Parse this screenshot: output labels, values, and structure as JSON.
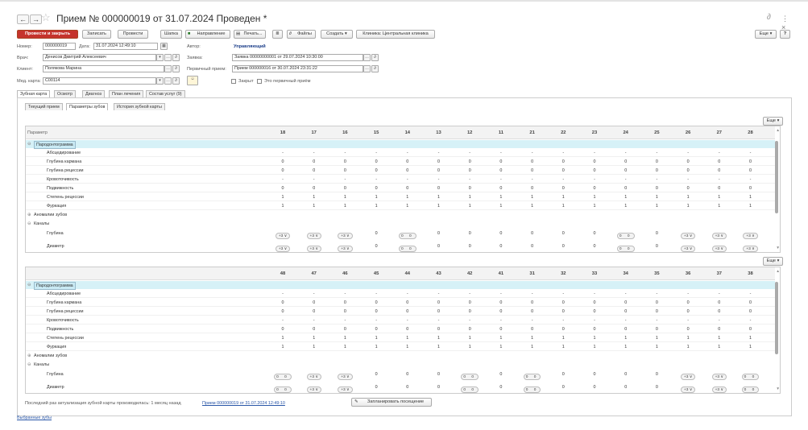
{
  "window": {
    "title": "Прием № 000000019 от 31.07.2024 Проведен *",
    "back": "←",
    "forward": "→",
    "star": "☆",
    "icons": "⋮ ×",
    "link_icon": "∂"
  },
  "toolbar": {
    "post_close": "Провести и закрыть",
    "save": "Записать",
    "post": "Провести",
    "header": "Шапка",
    "direction": "Направление",
    "print": "Печать...",
    "files": "Файлы",
    "create": "Создать",
    "clinic": "Клиника: Центральная клиника",
    "more": "Еще",
    "help": "?"
  },
  "form": {
    "number_label": "Номер:",
    "number": "000000019",
    "date_label": "Дата:",
    "date": "31.07.2024 12:49:10",
    "author_label": "Автор:",
    "author": "Управляющий",
    "doctor_label": "Врач:",
    "doctor": "Денисов Дмитрий Алексеевич",
    "request_label": "Заявка:",
    "request": "Заявка 00000000001 от 29.07.2024 10:30:00",
    "client_label": "Клиент:",
    "client": "Полякова Марина",
    "primary_label": "Первичный прием:",
    "primary": "Прием 000000016 от 30.07.2024 23:31:22",
    "card_label": "Мед. карта:",
    "card": "С00114",
    "closed_label": "Закрыт",
    "first_label": "Это первичный приём"
  },
  "tabs": [
    "Зубная карта",
    "Осмотр",
    "Диагноз",
    "План лечения",
    "Состав услуг (9)"
  ],
  "subtabs": [
    "Текущий прием",
    "Параметры зубов",
    "История зубной карты"
  ],
  "grid_more": "Еще",
  "upper": {
    "header_param": "Параметр",
    "teeth": [
      "18",
      "17",
      "16",
      "15",
      "14",
      "13",
      "12",
      "11",
      "21",
      "22",
      "23",
      "24",
      "25",
      "26",
      "27",
      "28"
    ],
    "group": "Пародонтограмма",
    "rows": [
      {
        "name": "Абсцедирование",
        "values": [
          "-",
          "-",
          "-",
          "-",
          "-",
          "-",
          "-",
          "-",
          "-",
          "-",
          "-",
          "-",
          "-",
          "-",
          "-",
          "-"
        ]
      },
      {
        "name": "Глубина кармана",
        "values": [
          "0",
          "0",
          "0",
          "0",
          "0",
          "0",
          "0",
          "0",
          "0",
          "0",
          "0",
          "0",
          "0",
          "0",
          "0",
          "0"
        ]
      },
      {
        "name": "Глубина рецессии",
        "values": [
          "0",
          "0",
          "0",
          "0",
          "0",
          "0",
          "0",
          "0",
          "0",
          "0",
          "0",
          "0",
          "0",
          "0",
          "0",
          "0"
        ]
      },
      {
        "name": "Кровоточивость",
        "values": [
          "-",
          "-",
          "-",
          "-",
          "-",
          "-",
          "-",
          "-",
          "-",
          "-",
          "-",
          "-",
          "-",
          "-",
          "-",
          "-"
        ]
      },
      {
        "name": "Подвижность",
        "values": [
          "0",
          "0",
          "0",
          "0",
          "0",
          "0",
          "0",
          "0",
          "0",
          "0",
          "0",
          "0",
          "0",
          "0",
          "0",
          "0"
        ]
      },
      {
        "name": "Степень рецессии",
        "values": [
          "1",
          "1",
          "1",
          "1",
          "1",
          "1",
          "1",
          "1",
          "1",
          "1",
          "1",
          "1",
          "1",
          "1",
          "1",
          "1"
        ]
      },
      {
        "name": "Фуркация",
        "values": [
          "1",
          "1",
          "1",
          "1",
          "1",
          "1",
          "1",
          "1",
          "1",
          "1",
          "1",
          "1",
          "1",
          "1",
          "1",
          "1"
        ]
      }
    ],
    "anomalies": "Аномалии зубов",
    "canals": "Каналы",
    "depth": "Глубина",
    "diameter": "Диаметр",
    "depth_values": [
      "+3 ∨",
      "+3 ∨",
      "+3 ∨",
      "0",
      "0 0",
      "0",
      "0",
      "0",
      "0",
      "0",
      "0",
      "0 0",
      "0",
      "+3 ∨",
      "+3 ∨",
      "+3 ∨"
    ],
    "diam_values": [
      "+3 ∨",
      "+3 ∨",
      "+3 ∨",
      "0",
      "0 0",
      "0",
      "0",
      "0",
      "0",
      "0",
      "0",
      "0 0",
      "0",
      "+3 ∨",
      "+3 ∨",
      "+3 ∨"
    ]
  },
  "lower": {
    "teeth": [
      "48",
      "47",
      "46",
      "45",
      "44",
      "43",
      "42",
      "41",
      "31",
      "32",
      "33",
      "34",
      "35",
      "36",
      "37",
      "38"
    ],
    "group": "Пародонтограмма",
    "rows": [
      {
        "name": "Абсцедирование",
        "values": [
          "-",
          "-",
          "-",
          "-",
          "-",
          "-",
          "-",
          "-",
          "-",
          "-",
          "-",
          "-",
          "-",
          "-",
          "-",
          "-"
        ]
      },
      {
        "name": "Глубина кармана",
        "values": [
          "0",
          "0",
          "0",
          "0",
          "0",
          "0",
          "0",
          "0",
          "0",
          "0",
          "0",
          "0",
          "0",
          "0",
          "0",
          "0"
        ]
      },
      {
        "name": "Глубина рецессии",
        "values": [
          "0",
          "0",
          "0",
          "0",
          "0",
          "0",
          "0",
          "0",
          "0",
          "0",
          "0",
          "0",
          "0",
          "0",
          "0",
          "0"
        ]
      },
      {
        "name": "Кровоточивость",
        "values": [
          "-",
          "-",
          "-",
          "-",
          "-",
          "-",
          "-",
          "-",
          "-",
          "-",
          "-",
          "-",
          "-",
          "-",
          "-",
          "-"
        ]
      },
      {
        "name": "Подвижность",
        "values": [
          "0",
          "0",
          "0",
          "0",
          "0",
          "0",
          "0",
          "0",
          "0",
          "0",
          "0",
          "0",
          "0",
          "0",
          "0",
          "0"
        ]
      },
      {
        "name": "Степень рецессии",
        "values": [
          "1",
          "1",
          "1",
          "1",
          "1",
          "1",
          "1",
          "1",
          "1",
          "1",
          "1",
          "1",
          "1",
          "1",
          "1",
          "1"
        ]
      },
      {
        "name": "Фуркация",
        "values": [
          "1",
          "1",
          "1",
          "1",
          "1",
          "1",
          "1",
          "1",
          "1",
          "1",
          "1",
          "1",
          "1",
          "1",
          "1",
          "1"
        ]
      }
    ],
    "anomalies": "Аномалии зубов",
    "canals": "Каналы",
    "depth": "Глубина",
    "diameter": "Диаметр",
    "depth_values": [
      "0 0",
      "+3 ∨",
      "+3 ∨",
      "0",
      "0",
      "0",
      "0 0",
      "0",
      "0 0",
      "0",
      "0",
      "0",
      "0",
      "+3 ∨",
      "+3 ∨",
      "0 0"
    ],
    "diam_values": [
      "0 0",
      "+3 ∨",
      "+3 ∨",
      "0",
      "0",
      "0",
      "0 0",
      "0",
      "0 0",
      "0",
      "0",
      "0",
      "0",
      "+3 ∨",
      "+3 ∨",
      "0 0"
    ]
  },
  "footer": {
    "text": "Последний раз актуализация зубной карты производилась:  1 месяц назад",
    "link": "Прием 000000019 от 31.07.2024 12:49:10",
    "schedule": "Запланировать посещение",
    "selected": "Выбранные зубы"
  }
}
